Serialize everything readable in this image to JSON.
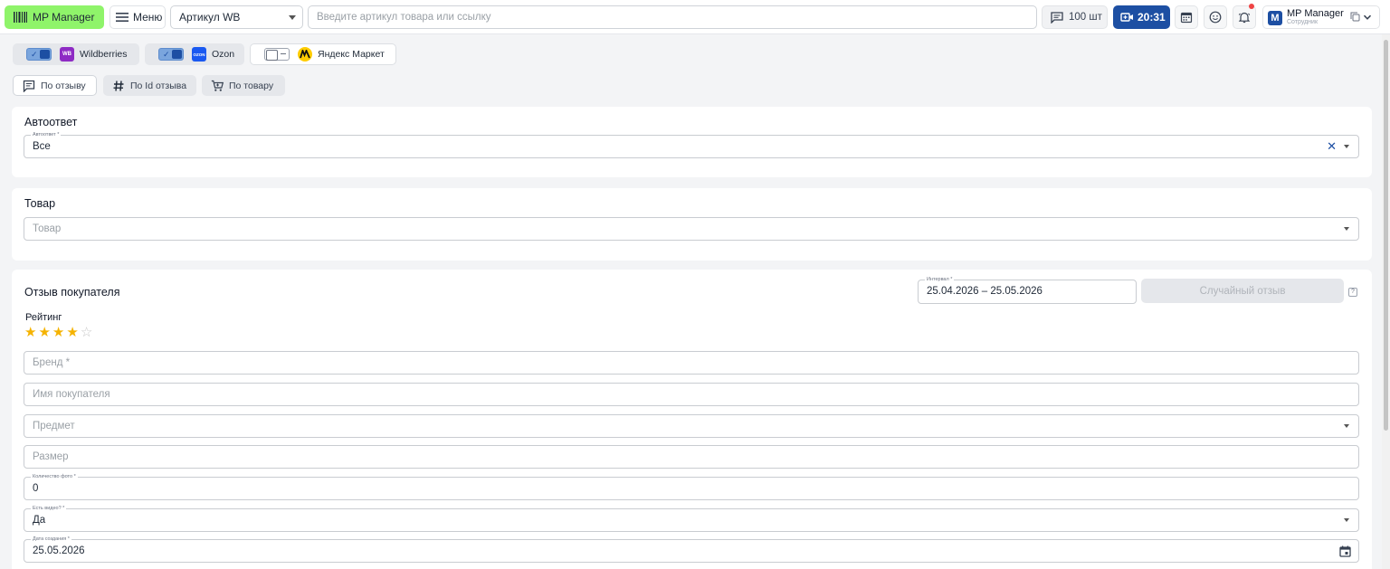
{
  "topbar": {
    "logo_label": "MP Manager",
    "menu_label": "Меню",
    "article_select": "Артикул WB",
    "search_placeholder": "Введите артикул товара или ссылку",
    "count_label": "100 шт",
    "time_label": "20:31",
    "user_name": "MP Manager",
    "user_role": "Сотрудник",
    "user_avatar_letter": "M",
    "icons": [
      "calendar-icon",
      "smile-icon",
      "bell-icon",
      "copy-icon",
      "chevron-down-icon"
    ]
  },
  "marketplaces": [
    {
      "label": "Wildberries",
      "enabled": true,
      "logo_text": "WB",
      "color": "#8e2bc4"
    },
    {
      "label": "Ozon",
      "enabled": true,
      "logo_text": "OZON",
      "color": "#1a59f1"
    },
    {
      "label": "Яндекс Маркет",
      "enabled": false,
      "logo_text": "",
      "color": "#ffcc00"
    }
  ],
  "filter_tabs": [
    {
      "label": "По отзыву",
      "active": true,
      "icon": "comment-icon"
    },
    {
      "label": "По Id отзыва",
      "active": false,
      "icon": "hash-icon"
    },
    {
      "label": "По товару",
      "active": false,
      "icon": "cart-icon"
    }
  ],
  "autoanswer": {
    "title": "Автоответ",
    "field_label": "Автоответ *",
    "value": "Все"
  },
  "product": {
    "title": "Товар",
    "placeholder": "Товар"
  },
  "review": {
    "title": "Отзыв покупателя",
    "interval_label": "Интервал *",
    "interval_value": "25.04.2026 – 25.05.2026",
    "random_button": "Случайный отзыв",
    "rating_label": "Рейтинг",
    "rating": 4,
    "rating_max": 5,
    "brand_placeholder": "Бренд *",
    "buyer_placeholder": "Имя покупателя",
    "subject_placeholder": "Предмет",
    "size_placeholder": "Размер",
    "photo_count_label": "Количество фото *",
    "photo_count_value": "0",
    "has_video_label": "Есть видео? *",
    "has_video_value": "Да",
    "created_label": "Дата создания *",
    "created_value": "25.05.2026"
  },
  "colors": {
    "accent": "#1d4fa3",
    "logo_green": "#8ff46a",
    "star": "#f5b301"
  }
}
